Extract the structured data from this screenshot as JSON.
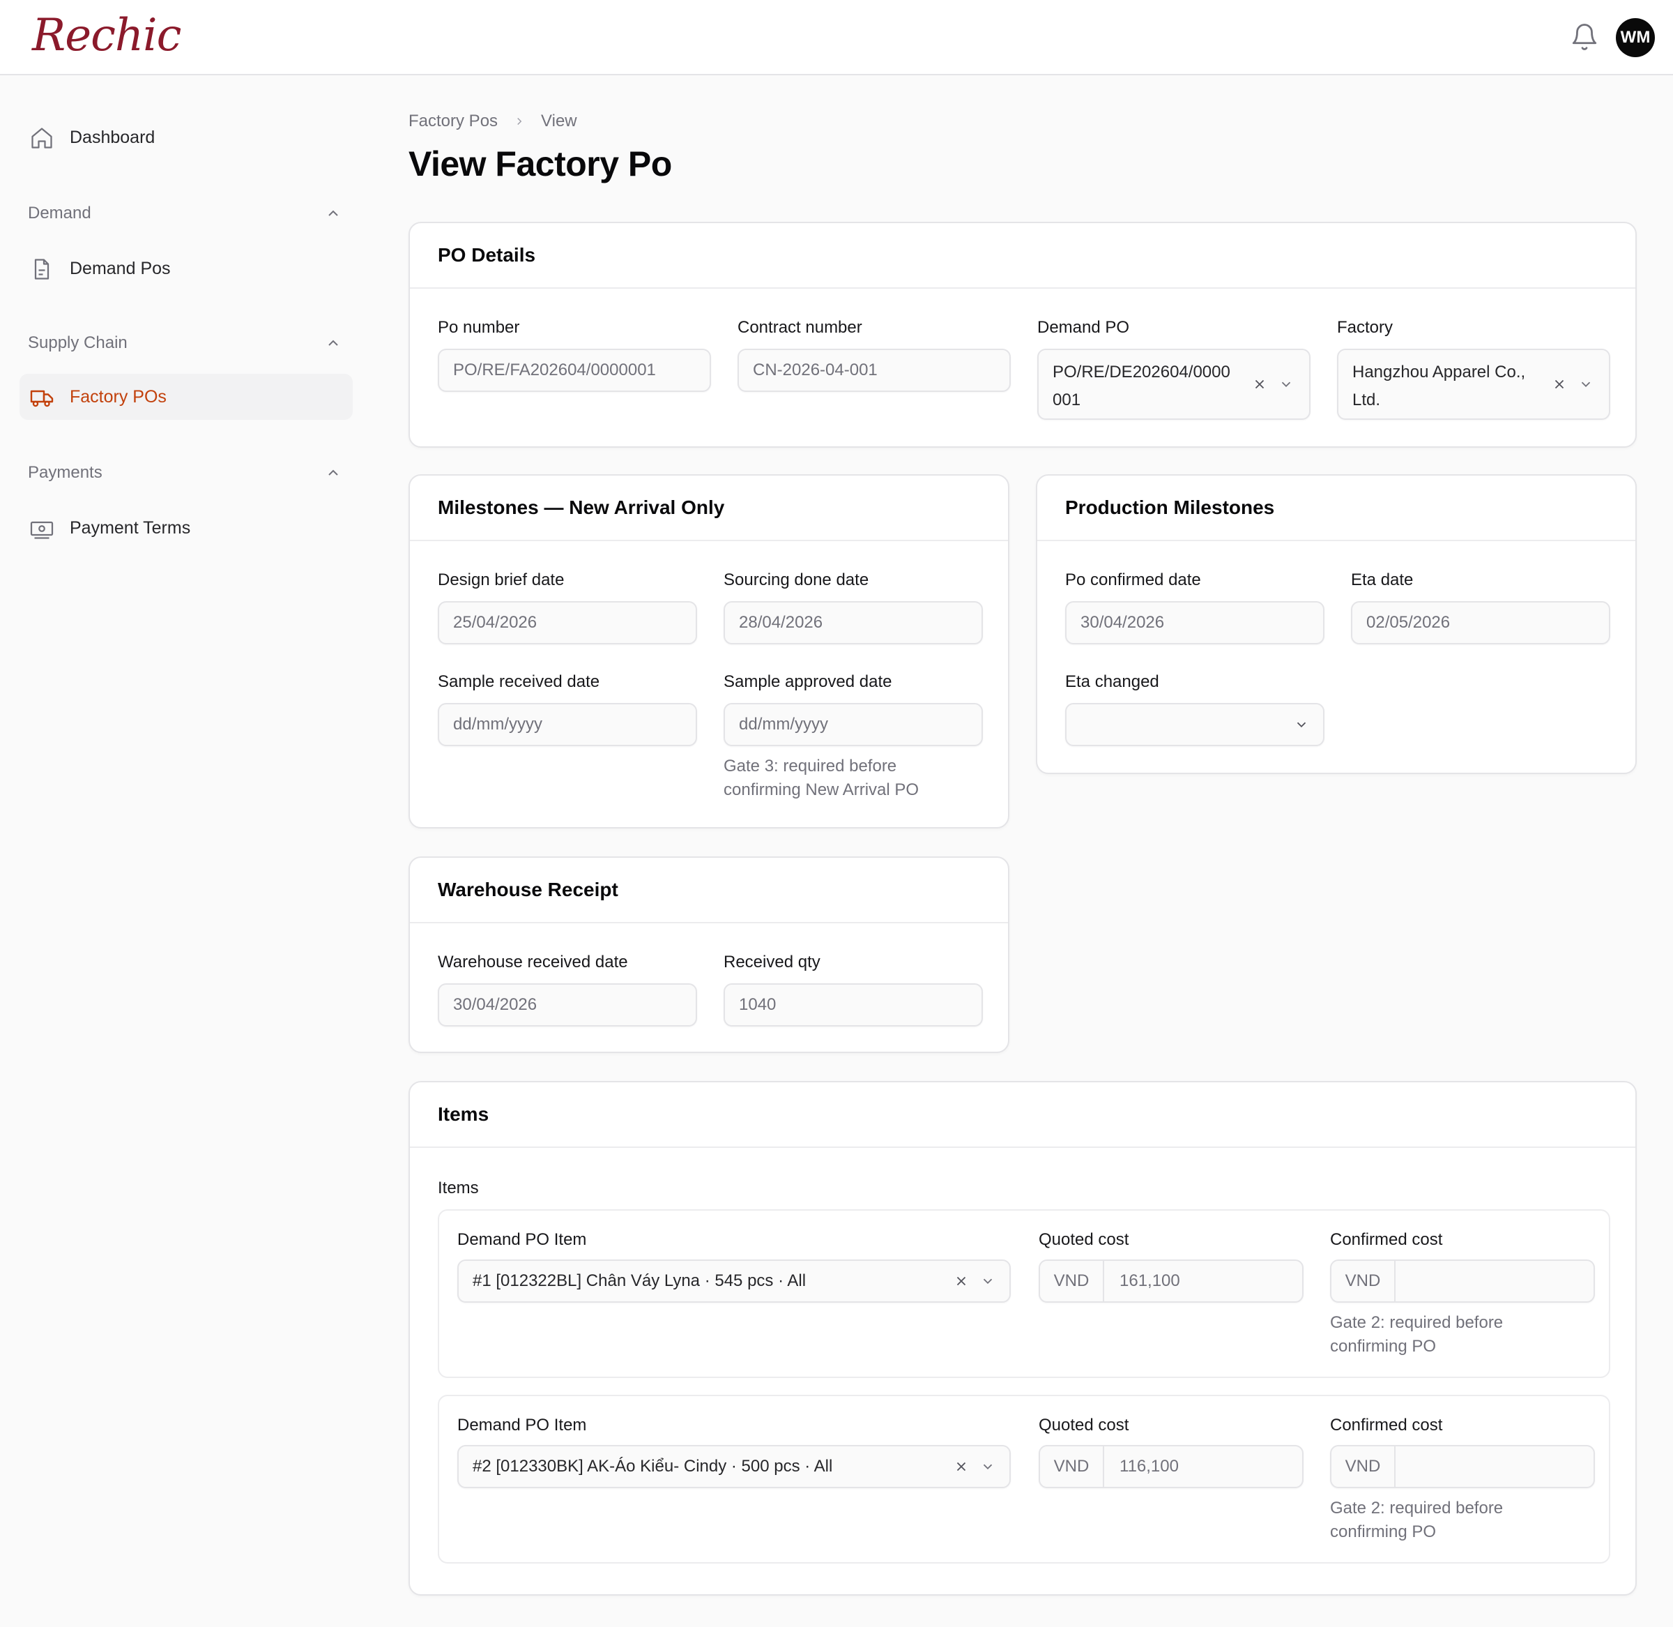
{
  "app": {
    "logo": "Rechic",
    "user_initials": "WM"
  },
  "sidebar": {
    "dashboard": "Dashboard",
    "groups": [
      {
        "label": "Demand",
        "items": [
          "Demand Pos"
        ]
      },
      {
        "label": "Supply Chain",
        "items": [
          "Factory POs"
        ]
      },
      {
        "label": "Payments",
        "items": [
          "Payment Terms"
        ]
      }
    ],
    "active_item": "Factory POs",
    "accent_color": "#c2410c"
  },
  "breadcrumb": {
    "parent": "Factory Pos",
    "current": "View"
  },
  "page_title": "View Factory Po",
  "po_details": {
    "title": "PO Details",
    "po_number": {
      "label": "Po number",
      "value": "PO/RE/FA202604/0000001"
    },
    "contract_number": {
      "label": "Contract number",
      "value": "CN-2026-04-001"
    },
    "demand_po": {
      "label": "Demand PO",
      "value_line1": "PO/RE/DE202604/0000",
      "value_line2": "001"
    },
    "factory": {
      "label": "Factory",
      "value_line1": "Hangzhou Apparel Co.,",
      "value_line2": "Ltd."
    }
  },
  "milestones_new": {
    "title": "Milestones — New Arrival Only",
    "design_brief": {
      "label": "Design brief date",
      "value": "25/04/2026"
    },
    "sourcing_done": {
      "label": "Sourcing done date",
      "value": "28/04/2026"
    },
    "sample_received": {
      "label": "Sample received date",
      "placeholder": "dd/mm/yyyy"
    },
    "sample_approved": {
      "label": "Sample approved date",
      "placeholder": "dd/mm/yyyy",
      "hint_line1": "Gate 3: required before",
      "hint_line2": "confirming New Arrival PO"
    }
  },
  "production_milestones": {
    "title": "Production Milestones",
    "po_confirmed": {
      "label": "Po confirmed date",
      "value": "30/04/2026"
    },
    "eta": {
      "label": "Eta date",
      "value": "02/05/2026"
    },
    "eta_changed": {
      "label": "Eta changed",
      "value": ""
    }
  },
  "warehouse": {
    "title": "Warehouse Receipt",
    "received_date": {
      "label": "Warehouse received date",
      "value": "30/04/2026"
    },
    "received_qty": {
      "label": "Received qty",
      "value": "1040"
    }
  },
  "items": {
    "title": "Items",
    "sublabel": "Items",
    "col_item": "Demand PO Item",
    "col_quoted": "Quoted cost",
    "col_confirmed": "Confirmed cost",
    "currency": "VND",
    "rows": [
      {
        "item": "#1 [012322BL] Chân Váy Lyna · 545 pcs · All",
        "quoted": "161,100",
        "confirmed": "",
        "hint_line1": "Gate 2: required before",
        "hint_line2": "confirming PO"
      },
      {
        "item": "#2 [012330BK] AK-Áo Kiểu- Cindy · 500 pcs · All",
        "quoted": "116,100",
        "confirmed": "",
        "hint_line1": "Gate 2: required before",
        "hint_line2": "confirming PO"
      }
    ]
  }
}
